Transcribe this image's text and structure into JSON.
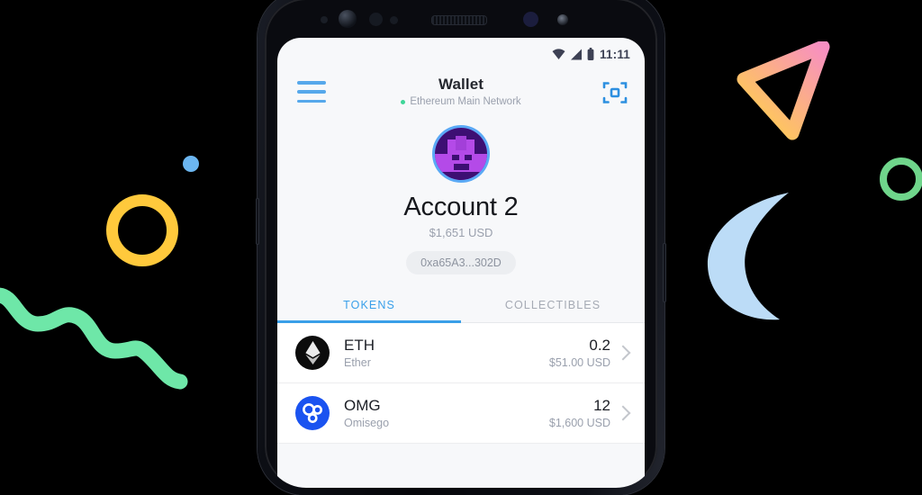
{
  "statusbar": {
    "time": "11:11",
    "icons": [
      "wifi-icon",
      "cellular-signal-icon",
      "battery-icon"
    ]
  },
  "appbar": {
    "menu_icon": "hamburger-menu-icon",
    "title": "Wallet",
    "network": "Ethereum Main Network",
    "network_status_color": "#3ed598",
    "scan_icon": "qr-scan-icon"
  },
  "account": {
    "avatar": "account-identicon",
    "name": "Account 2",
    "fiat_balance": "$1,651 USD",
    "address": "0xa65A3...302D"
  },
  "tabs": [
    {
      "label": "TOKENS",
      "active": true
    },
    {
      "label": "COLLECTIBLES",
      "active": false
    }
  ],
  "tokens": [
    {
      "icon": "ethereum-icon",
      "symbol": "ETH",
      "name": "Ether",
      "amount": "0.2",
      "fiat": "$51.00 USD"
    },
    {
      "icon": "omisego-icon",
      "symbol": "OMG",
      "name": "Omisego",
      "amount": "12",
      "fiat": "$1,600 USD"
    }
  ],
  "theme": {
    "accent": "#3a9fe8",
    "screen_bg": "#f7f8fa",
    "list_bg": "#ffffff",
    "muted_text": "#9aa0ad",
    "primary_text": "#1c1f26"
  },
  "decorations": [
    {
      "name": "blue-dot",
      "color": "#6cb6f0"
    },
    {
      "name": "yellow-ring",
      "color": "#ffc93c"
    },
    {
      "name": "green-wave",
      "color": "#6ee7a8"
    },
    {
      "name": "gradient-triangle",
      "colors": [
        "#f78fc2",
        "#ffd24a"
      ]
    },
    {
      "name": "green-ring",
      "color": "#6fd58b"
    },
    {
      "name": "blue-crescent",
      "color": "#bcdcf7"
    }
  ]
}
